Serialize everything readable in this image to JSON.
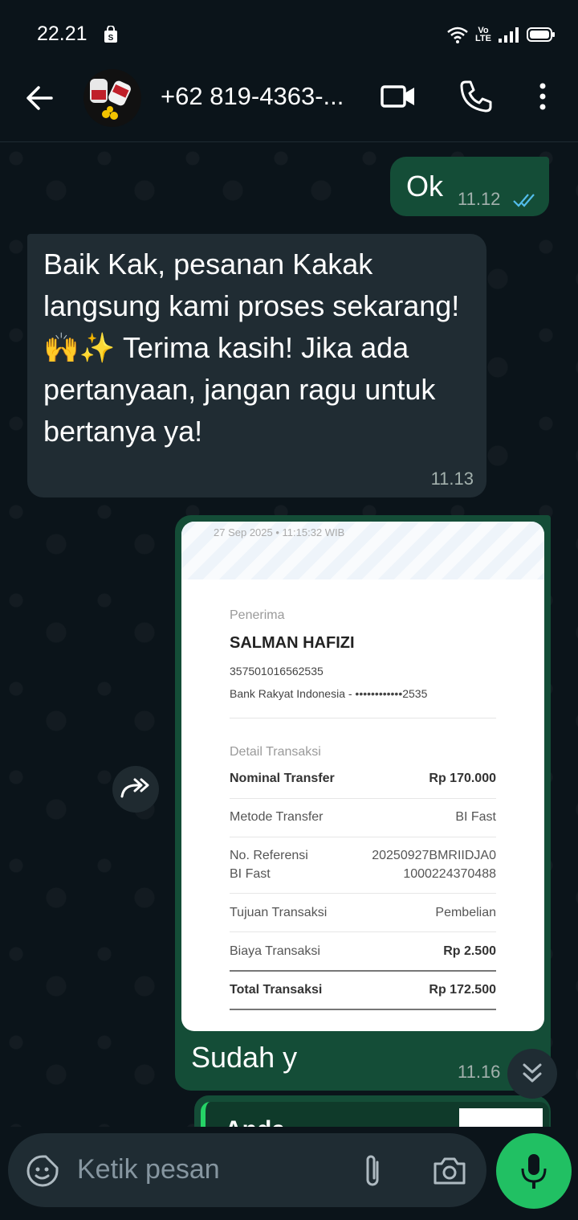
{
  "status_bar": {
    "time": "22.21",
    "volte_line1": "Vo",
    "volte_line2": "LTE"
  },
  "header": {
    "contact_name": "+62 819-4363-..."
  },
  "messages": [
    {
      "type": "outgoing",
      "text": "Ok",
      "time": "11.12",
      "status": "read"
    },
    {
      "type": "incoming",
      "text": "Baik Kak, pesanan Kakak langsung kami proses sekarang! 🙌✨ Terima kasih! Jika ada pertanyaan, jangan ragu untuk bertanya ya!",
      "time": "11.13"
    },
    {
      "type": "outgoing_image",
      "caption": "Sudah y",
      "time": "11.16"
    },
    {
      "type": "outgoing_partial",
      "text": "Anda"
    }
  ],
  "receipt": {
    "timestamp": "27 Sep 2025 • 11:15:32 WIB",
    "recipient_label": "Penerima",
    "recipient_name": "SALMAN HAFIZI",
    "account_number": "357501016562535",
    "bank": "Bank Rakyat Indonesia - ••••••••••••2535",
    "detail_label": "Detail Transaksi",
    "rows": [
      {
        "label": "Nominal Transfer",
        "value": "Rp 170.000"
      },
      {
        "label": "Metode Transfer",
        "value": "BI Fast"
      },
      {
        "label": "No. Referensi",
        "label2": "BI Fast",
        "value": "20250927BMRIIDJA0",
        "value2": "1000224370488"
      },
      {
        "label": "Tujuan Transaksi",
        "value": "Pembelian"
      },
      {
        "label": "Biaya Transaksi",
        "value": "Rp 2.500"
      },
      {
        "label": "Total Transaksi",
        "value": "Rp 172.500"
      }
    ]
  },
  "input": {
    "placeholder": "Ketik pesan"
  },
  "colors": {
    "outgoing_bubble": "#144d37",
    "incoming_bubble": "#202c33",
    "accent": "#21c063",
    "read_tick": "#53bdeb"
  }
}
